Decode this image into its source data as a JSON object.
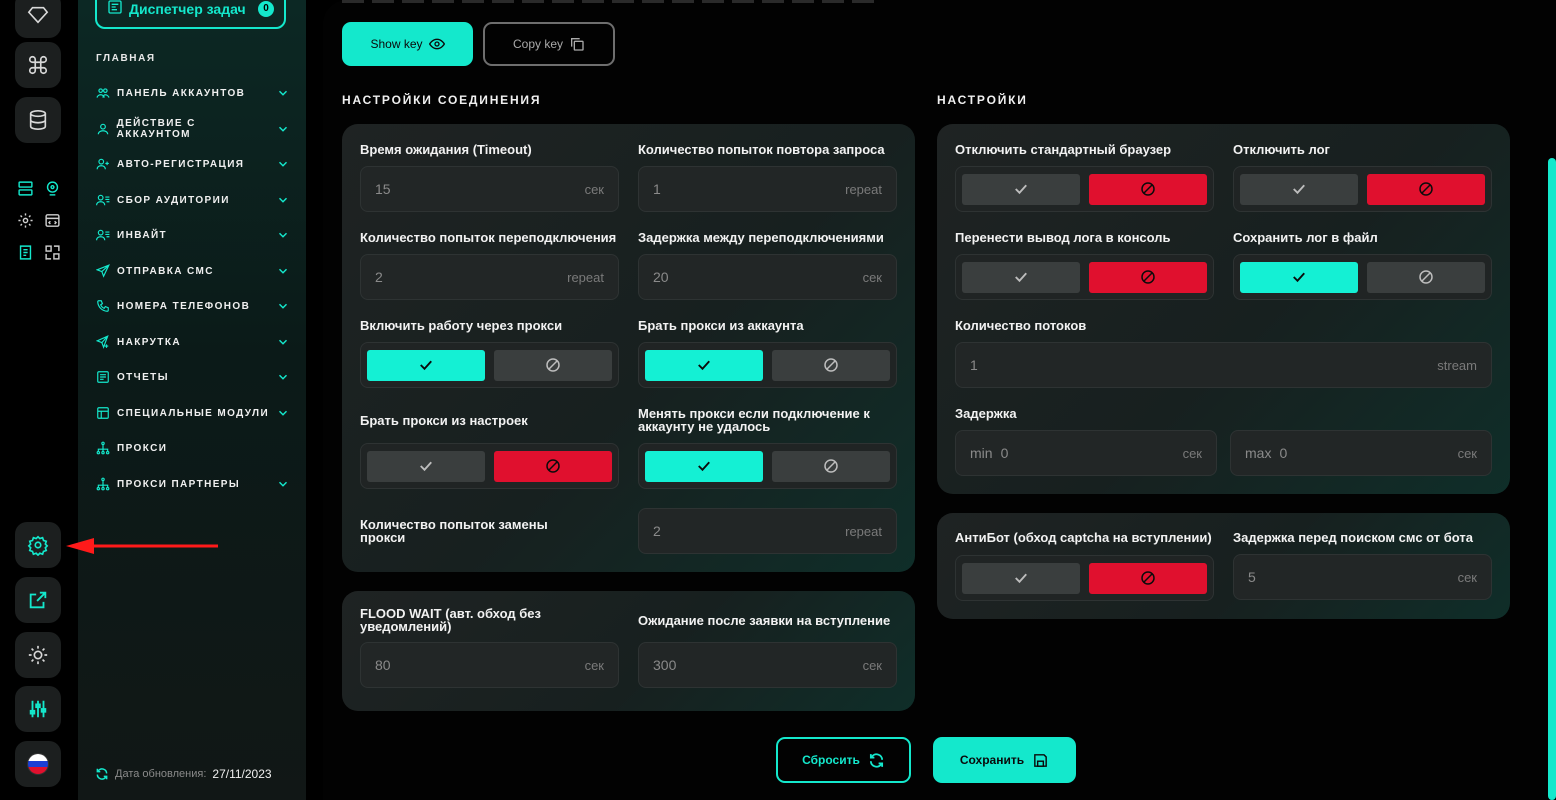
{
  "task_manager": {
    "label": "Диспетчер задач",
    "count": "0"
  },
  "menu": {
    "title": "ГЛАВНАЯ",
    "items": [
      {
        "label": "ПАНЕЛЬ АККАУНТОВ",
        "icon": "users-icon",
        "expandable": true
      },
      {
        "label": "ДЕЙСТВИЕ С АККАУНТОМ",
        "icon": "user-icon",
        "expandable": true
      },
      {
        "label": "АВТО-РЕГИСТРАЦИЯ",
        "icon": "user-plus-icon",
        "expandable": true
      },
      {
        "label": "СБОР АУДИТОРИИ",
        "icon": "user-list-icon",
        "expandable": true
      },
      {
        "label": "ИНВАЙТ",
        "icon": "user-list-icon",
        "expandable": true
      },
      {
        "label": "ОТПРАВКА СМС",
        "icon": "send-icon",
        "expandable": true
      },
      {
        "label": "НОМЕРА ТЕЛЕФОНОВ",
        "icon": "phone-icon",
        "expandable": true
      },
      {
        "label": "НАКРУТКА",
        "icon": "send-plus-icon",
        "expandable": true
      },
      {
        "label": "ОТЧЕТЫ",
        "icon": "report-icon",
        "expandable": true
      },
      {
        "label": "СПЕЦИАЛЬНЫЕ МОДУЛИ",
        "icon": "modules-icon",
        "expandable": true
      },
      {
        "label": "ПРОКСИ",
        "icon": "network-icon",
        "expandable": false
      },
      {
        "label": "ПРОКСИ ПАРТНЕРЫ",
        "icon": "network-icon",
        "expandable": true
      }
    ]
  },
  "update": {
    "label": "Дата обновления:",
    "date": "27/11/2023"
  },
  "key": {
    "show_label": "Show key",
    "copy_label": "Copy key"
  },
  "connection": {
    "title": "НАСТРОЙКИ СОЕДИНЕНИЯ",
    "timeout": {
      "label": "Время ожидания (Timeout)",
      "value": "15",
      "unit": "сек"
    },
    "retry_count": {
      "label": "Количество попыток повтора запроса",
      "value": "1",
      "unit": "repeat"
    },
    "reconnect_count": {
      "label": "Количество попыток переподключения",
      "value": "2",
      "unit": "repeat"
    },
    "reconnect_delay": {
      "label": "Задержка между переподключениями",
      "value": "20",
      "unit": "сек"
    },
    "use_proxy": {
      "label": "Включить работу через прокси",
      "enabled": true
    },
    "proxy_from_account": {
      "label": "Брать прокси из аккаунта",
      "enabled": true
    },
    "proxy_from_settings": {
      "label": "Брать прокси из настроек",
      "enabled": false
    },
    "change_proxy_on_fail": {
      "label": "Менять прокси если подключение к аккаунту не удалось",
      "enabled": true
    },
    "proxy_replace_count": {
      "label": "Количество попыток замены прокси",
      "value": "2",
      "unit": "repeat"
    }
  },
  "flood": {
    "flood_wait": {
      "label": "FLOOD WAIT (авт. обход без уведомлений)",
      "value": "80",
      "unit": "сек"
    },
    "join_wait": {
      "label": "Ожидание после заявки на вступление",
      "value": "300",
      "unit": "сек"
    }
  },
  "settings": {
    "title": "НАСТРОЙКИ",
    "disable_browser": {
      "label": "Отключить стандартный браузер",
      "enabled": false
    },
    "disable_log": {
      "label": "Отключить лог",
      "enabled": false
    },
    "log_to_console": {
      "label": "Перенести вывод лога в консоль",
      "enabled": false
    },
    "log_to_file": {
      "label": "Сохранить лог в файл",
      "enabled": true
    },
    "threads": {
      "label": "Количество потоков",
      "value": "1",
      "unit": "stream"
    },
    "delay": {
      "label": "Задержка",
      "min_prefix": "min",
      "min_value": "0",
      "max_prefix": "max",
      "max_value": "0",
      "unit": "сек"
    }
  },
  "antibot": {
    "captcha": {
      "label": "АнтиБот (обход captcha на вступлении)",
      "enabled": false
    },
    "sms_delay": {
      "label": "Задержка перед поиском смс от бота",
      "value": "5",
      "unit": "сек"
    }
  },
  "actions": {
    "reset_label": "Сбросить",
    "save_label": "Сохранить"
  },
  "colors": {
    "accent": "#14e8cc",
    "danger": "#e0102e"
  }
}
